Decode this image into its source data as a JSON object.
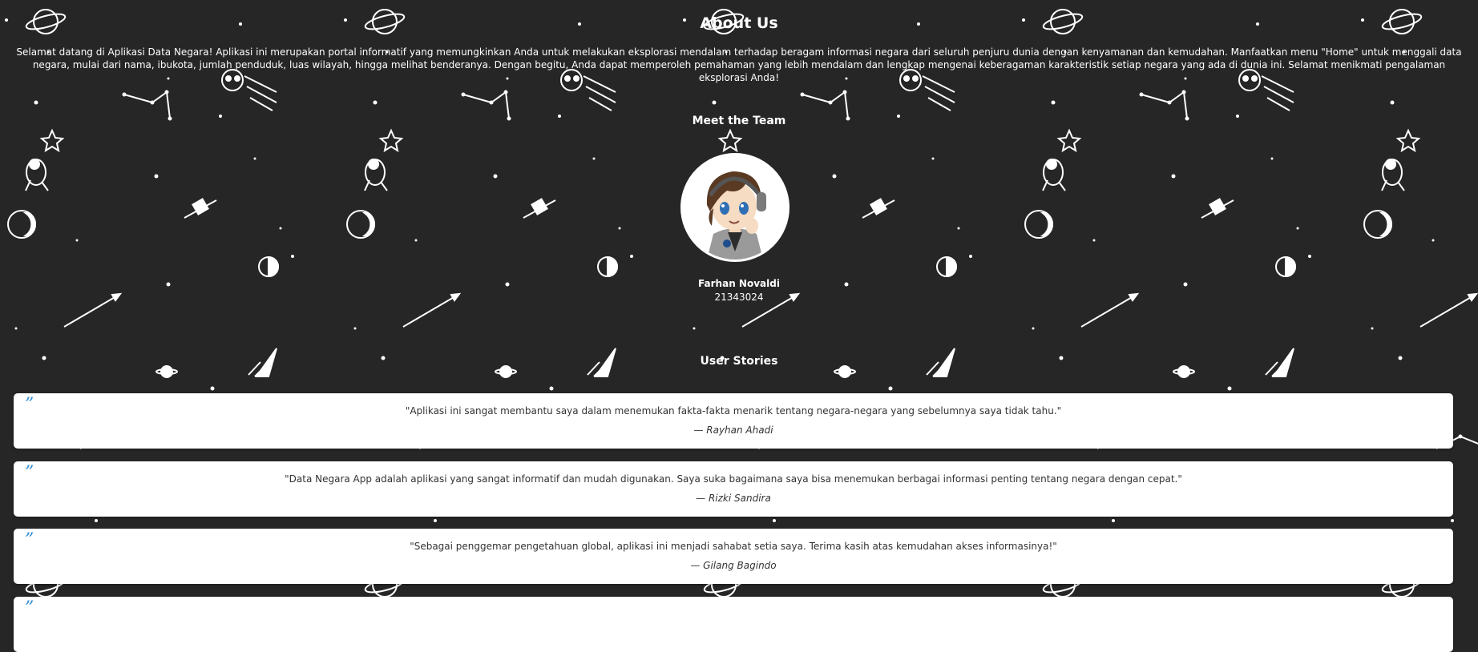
{
  "about": {
    "title": "About Us",
    "description": "Selamat datang di Aplikasi Data Negara! Aplikasi ini merupakan portal informatif yang memungkinkan Anda untuk melakukan eksplorasi mendalam terhadap beragam informasi negara dari seluruh penjuru dunia dengan kenyamanan dan kemudahan. Manfaatkan menu \"Home\" untuk menggali data negara, mulai dari nama, ibukota, jumlah penduduk, luas wilayah, hingga melihat benderanya. Dengan begitu, Anda dapat memperoleh pemahaman yang lebih mendalam dan lengkap mengenai keberagaman karakteristik setiap negara yang ada di dunia ini. Selamat menikmati pengalaman eksplorasi Anda!"
  },
  "team": {
    "title": "Meet the Team",
    "members": [
      {
        "name": "Farhan Novaldi",
        "id": "21343024"
      }
    ]
  },
  "stories": {
    "title": "User Stories",
    "quote_mark": "”",
    "items": [
      {
        "text": "\"Aplikasi ini sangat membantu saya dalam menemukan fakta-fakta menarik tentang negara-negara yang sebelumnya saya tidak tahu.\"",
        "author": "— Rayhan Ahadi"
      },
      {
        "text": "\"Data Negara App adalah aplikasi yang sangat informatif dan mudah digunakan. Saya suka bagaimana saya bisa menemukan berbagai informasi penting tentang negara dengan cepat.\"",
        "author": "— Rizki Sandira"
      },
      {
        "text": "\"Sebagai penggemar pengetahuan global, aplikasi ini menjadi sahabat setia saya. Terima kasih atas kemudahan akses informasinya!\"",
        "author": "— Gilang Bagindo"
      },
      {
        "text": "",
        "author": ""
      }
    ]
  },
  "colors": {
    "background": "#262626",
    "accent_quote": "#2f8fd3",
    "card": "#ffffff"
  }
}
